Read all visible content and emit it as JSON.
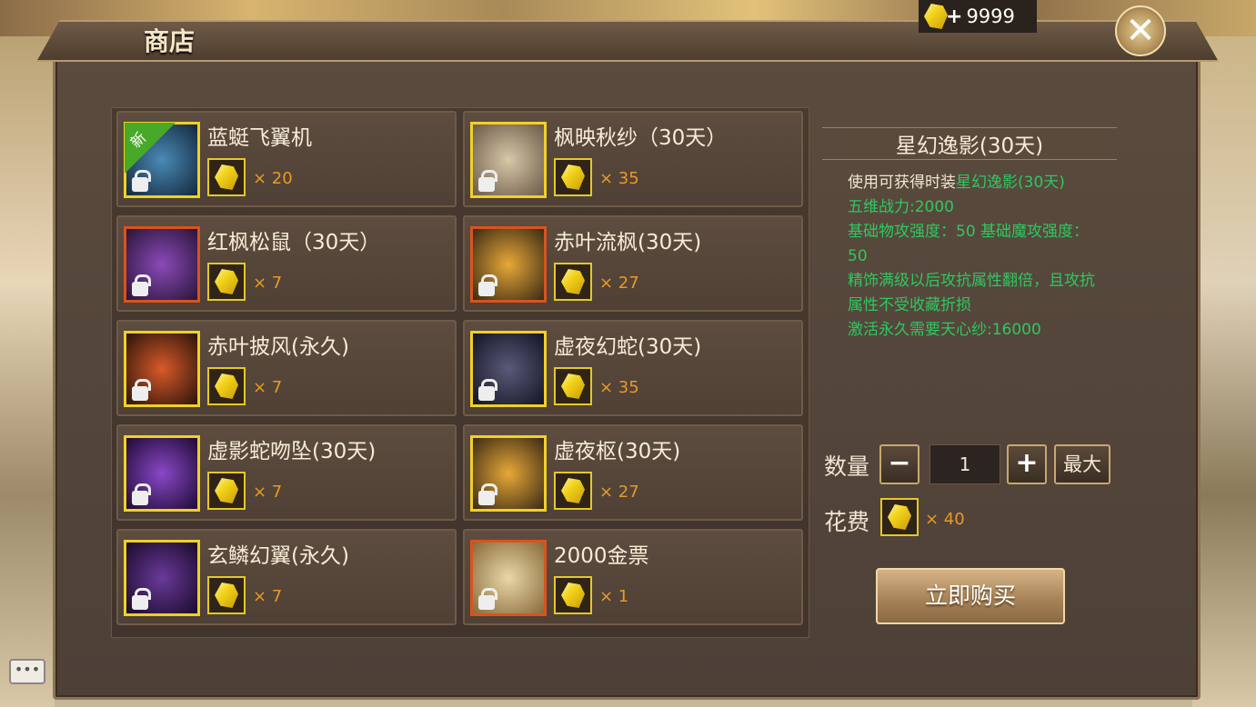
{
  "title": "商店",
  "currency": {
    "amount": "9999",
    "plus": "+"
  },
  "close": "✕",
  "items": [
    {
      "name": "蓝蜓飞翼机",
      "price": "× 20",
      "new": "新",
      "frame": "yellow"
    },
    {
      "name": "枫映秋纱（30天）",
      "price": "× 35",
      "frame": "yellow"
    },
    {
      "name": "红枫松鼠（30天）",
      "price": "× 7",
      "frame": "orange"
    },
    {
      "name": "赤叶流枫(30天)",
      "price": "× 27",
      "frame": "orange"
    },
    {
      "name": "赤叶披风(永久)",
      "price": "× 7",
      "frame": "yellow"
    },
    {
      "name": "虚夜幻蛇(30天)",
      "price": "× 35",
      "frame": "yellow"
    },
    {
      "name": "虚影蛇吻坠(30天)",
      "price": "× 7",
      "frame": "yellow"
    },
    {
      "name": "虚夜枢(30天)",
      "price": "× 27",
      "frame": "yellow"
    },
    {
      "name": "玄鳞幻翼(永久)",
      "price": "× 7",
      "frame": "yellow"
    },
    {
      "name": "2000金票",
      "price": "× 1",
      "frame": "orange"
    }
  ],
  "detail": {
    "title": "星幻逸影(30天)",
    "desc_prefix": "使用可获得时装",
    "desc_item": "星幻逸影(30天)",
    "line1": "五维战力:2000",
    "line2": "基础物攻强度：50 基础魔攻强度：50",
    "line3": "精饰满级以后攻抗属性翻倍，且攻抗属性不受收藏折损",
    "line4": "激活永久需要天心纱:16000"
  },
  "quantity": {
    "label": "数量",
    "minus": "−",
    "value": "1",
    "plus": "+",
    "max": "最大"
  },
  "cost": {
    "label": "花费",
    "value": "× 40"
  },
  "buy_label": "立即购买",
  "chat_label": "•••",
  "colors": {
    "accent_green": "#2ec860",
    "price_orange": "#e89a28",
    "frame_yellow": "#f0d028",
    "frame_orange": "#d8541e"
  }
}
